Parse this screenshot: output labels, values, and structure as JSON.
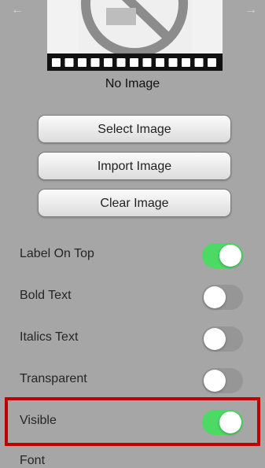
{
  "preview": {
    "caption": "No Image"
  },
  "buttons": {
    "select": "Select Image",
    "import": "Import Image",
    "clear": "Clear Image"
  },
  "toggles": [
    {
      "label": "Label On Top",
      "on": true
    },
    {
      "label": "Bold Text",
      "on": false
    },
    {
      "label": "Italics Text",
      "on": false
    },
    {
      "label": "Transparent",
      "on": false
    },
    {
      "label": "Visible",
      "on": true
    }
  ],
  "font_section": {
    "label": "Font"
  },
  "colors": {
    "toggle_on": "#4cd964",
    "highlight": "#c00000"
  }
}
